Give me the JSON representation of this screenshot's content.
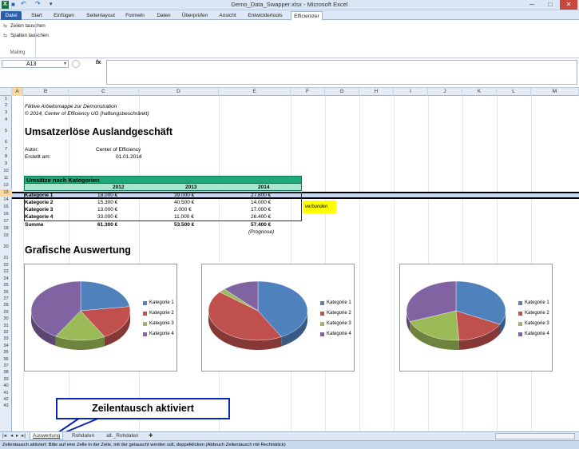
{
  "window": {
    "title": "Demo_Data_Swapper.xlsx - Microsoft Excel",
    "minimize_glyph": "─",
    "maximize_glyph": "□",
    "close_glyph": "✕"
  },
  "qat": {
    "icons": [
      "excel-icon",
      "save-icon",
      "undo-icon",
      "redo-icon",
      "customize-icon"
    ],
    "glyphs": [
      "X",
      "■",
      "↶",
      "↷",
      "▾"
    ]
  },
  "ribbon_tabs": [
    "Datei",
    "Start",
    "Einfügen",
    "Seitenlayout",
    "Formeln",
    "Daten",
    "Überprüfen",
    "Ansicht",
    "Entwicklertools",
    "Efficienizer"
  ],
  "ribbon": {
    "commands": [
      "Zeilen tauschen",
      "Spalten tauschen"
    ],
    "group_label": "Mailing"
  },
  "formula_bar": {
    "name_box": "A13",
    "fx_label": "fx",
    "formula": ""
  },
  "columns": [
    "A",
    "B",
    "C",
    "D",
    "E",
    "F",
    "G",
    "H",
    "I",
    "J",
    "K",
    "L",
    "M"
  ],
  "rows": [
    "1",
    "2",
    "3",
    "4",
    "5",
    "6",
    "7",
    "8",
    "9",
    "10",
    "11",
    "12",
    "13",
    "14",
    "15",
    "16",
    "17",
    "18",
    "19",
    "20",
    "21",
    "22",
    "23",
    "24",
    "25",
    "26",
    "27",
    "28",
    "29",
    "30",
    "31",
    "32",
    "33",
    "34",
    "35",
    "36",
    "37",
    "38",
    "39",
    "40",
    "41",
    "42",
    "43"
  ],
  "sheet": {
    "subtitle1": "Fiktive Arbeitsmappe zur Demonstration",
    "subtitle2": "© 2014, Center of Efficiency UG (haftungsbeschränkt)",
    "heading": "Umsatzerlöse Auslandgeschäft",
    "author_label": "Autor:",
    "author_value": "Center of Efficiency",
    "created_label": "Erstellt am:",
    "created_value": "01.01.2014",
    "table_title": "Umsätze nach Kategorien",
    "years": [
      "2012",
      "2013",
      "2014"
    ],
    "table_rows": [
      {
        "label": "Kategorie 1",
        "v": [
          "18.000 €",
          "39.000 €",
          "27.800 €"
        ]
      },
      {
        "label": "Kategorie 2",
        "v": [
          "15.300 €",
          "40.500 €",
          "14.000 €"
        ]
      },
      {
        "label": "Kategorie 3",
        "v": [
          "13.000 €",
          "2.000 €",
          "17.000 €"
        ]
      },
      {
        "label": "Kategorie 4",
        "v": [
          "33.000 €",
          "11.000 €",
          "26.400 €"
        ]
      }
    ],
    "sum_label": "Summe",
    "sums": [
      "61.300 €",
      "53.500 €",
      "57.400 €"
    ],
    "forecast_note": "(Prognose)",
    "linked_note": "verbunden",
    "section_heading": "Grafische Auswertung"
  },
  "chart_data": [
    {
      "type": "pie",
      "categories": [
        "Kategorie 1",
        "Kategorie 2",
        "Kategorie 3",
        "Kategorie 4"
      ],
      "values": [
        18000,
        15300,
        13000,
        33000
      ],
      "legend": "right"
    },
    {
      "type": "pie",
      "categories": [
        "Kategorie 1",
        "Kategorie 2",
        "Kategorie 3",
        "Kategorie 4"
      ],
      "values": [
        39000,
        40500,
        2000,
        11000
      ],
      "legend": "right"
    },
    {
      "type": "pie",
      "categories": [
        "Kategorie 1",
        "Kategorie 2",
        "Kategorie 3",
        "Kategorie 4"
      ],
      "values": [
        27800,
        14000,
        17000,
        26400
      ],
      "legend": "right"
    }
  ],
  "colors": {
    "k1": "#4f81bd",
    "k2": "#c0504d",
    "k3": "#9bbb59",
    "k4": "#8064a2"
  },
  "callout": "Zeilentausch aktiviert",
  "sheet_tabs": [
    "Auswertung",
    "Rohdaten",
    "alt._Rohdaten"
  ],
  "status": "Zeilentausch aktiviert: Bitte auf eine Zelle in der Zeile, mit der getauscht werden soll, doppelklicken (Abbruch Zeilentausch mit Rechtsklick)"
}
